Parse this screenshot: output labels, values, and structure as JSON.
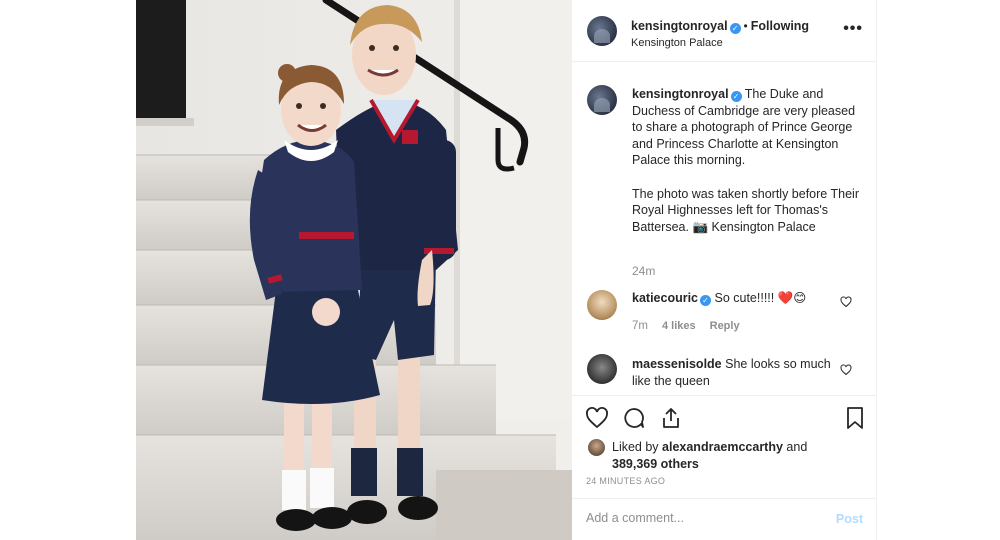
{
  "post": {
    "username": "kensingtonroyal",
    "follow_status": "Following",
    "location": "Kensington Palace",
    "more_icon": "more-options-icon"
  },
  "caption": {
    "username": "kensingtonroyal",
    "paragraph1": "The Duke and Duchess of Cambridge are very pleased to share a photograph of Prince George and Princess Charlotte at Kensington Palace this morning.",
    "paragraph2": "The photo was taken shortly before Their Royal Highnesses left for Thomas's Battersea. 📷 Kensington Palace",
    "time": "24m"
  },
  "comments": [
    {
      "username": "katiecouric",
      "verified": true,
      "text": "So cute!!!!! ❤️😊",
      "time": "7m",
      "likes": "4 likes",
      "reply": "Reply"
    },
    {
      "username": "maessenisolde",
      "verified": false,
      "text": "She looks so much like the queen"
    }
  ],
  "actions": {
    "liked_prefix": "Liked by ",
    "liked_user": "alexandraemccarthy",
    "liked_suffix": " and",
    "liked_count": "389,369 others",
    "time_ago": "24 MINUTES AGO"
  },
  "add_comment": {
    "placeholder": "Add a comment...",
    "post_label": "Post"
  },
  "colors": {
    "verified": "#3897f0",
    "post_disabled": "#b3dbff",
    "secondary_text": "#8e8e8e"
  }
}
